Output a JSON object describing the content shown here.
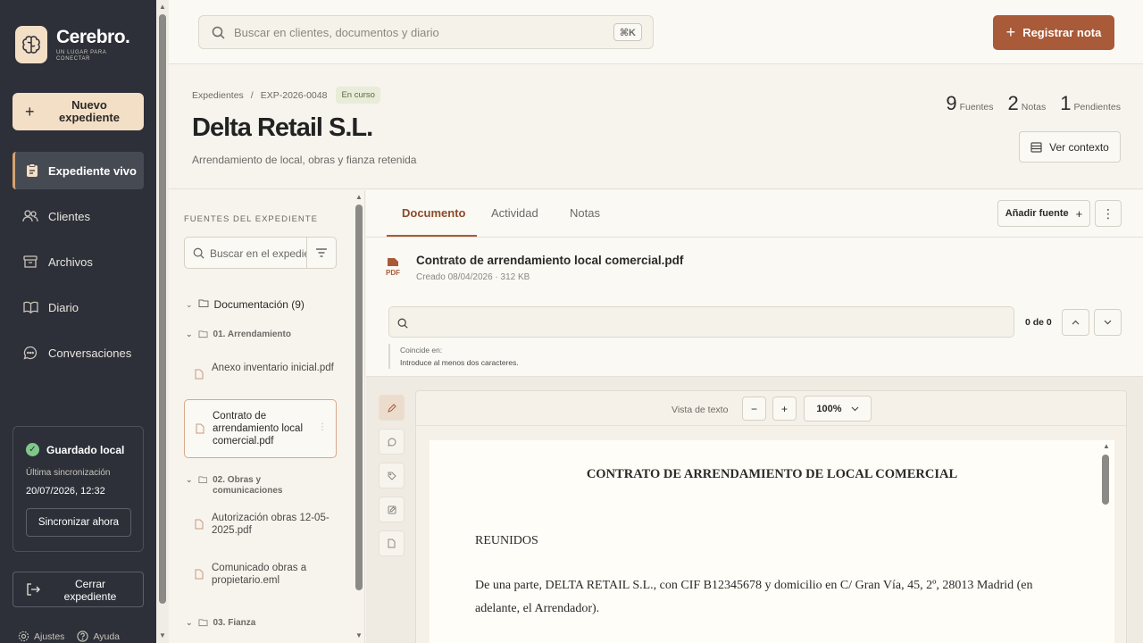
{
  "app": {
    "name": "Cerebro.",
    "tagline": "UN LUGAR PARA CONECTAR"
  },
  "sidebar": {
    "new_button": "Nuevo expediente",
    "items": [
      {
        "label": "Expediente vivo",
        "icon": "clipboard-icon",
        "active": true
      },
      {
        "label": "Clientes",
        "icon": "users-icon"
      },
      {
        "label": "Archivos",
        "icon": "archive-icon"
      },
      {
        "label": "Diario",
        "icon": "book-icon"
      },
      {
        "label": "Conversaciones",
        "icon": "chat-icon"
      }
    ],
    "sync": {
      "title": "Guardado local",
      "subtitle": "Última sincronización",
      "date": "20/07/2026, 12:32",
      "button": "Sincronizar ahora"
    },
    "close_button": "Cerrar expediente",
    "footer": {
      "settings": "Ajustes",
      "help": "Ayuda"
    }
  },
  "topbar": {
    "search_placeholder": "Buscar en clientes, documentos y diario",
    "shortcut": "⌘K",
    "register_button": "Registrar nota"
  },
  "header": {
    "breadcrumb": [
      "Expedientes",
      "EXP-2026-0048"
    ],
    "status": "En curso",
    "title": "Delta Retail S.L.",
    "subtitle": "Arrendamiento de local, obras y fianza retenida",
    "stats": [
      {
        "n": "9",
        "label": "Fuentes"
      },
      {
        "n": "2",
        "label": "Notas"
      },
      {
        "n": "1",
        "label": "Pendientes"
      }
    ],
    "context_button": "Ver contexto"
  },
  "sources": {
    "heading": "FUENTES DEL EXPEDIENTE",
    "search_placeholder": "Buscar en el expediente",
    "root": "Documentación (9)",
    "folders": [
      {
        "name": "01. Arrendamiento",
        "files": [
          "Anexo inventario inicial.pdf",
          "Contrato de arrendamiento local comercial.pdf"
        ]
      },
      {
        "name": "02. Obras y comunicaciones",
        "files": [
          "Autorización obras 12-05-2025.pdf",
          "Comunicado obras a propietario.eml"
        ]
      },
      {
        "name": "03. Fianza",
        "files": []
      }
    ]
  },
  "main": {
    "tabs": [
      "Documento",
      "Actividad",
      "Notas"
    ],
    "add_source": "Añadir fuente",
    "doc": {
      "type": "PDF",
      "name": "Contrato de arrendamiento local comercial.pdf",
      "meta": "Creado 08/04/2026 · 312 KB"
    },
    "find": {
      "count": "0 de 0",
      "hint_label": "Coincide en:",
      "hint_text": "Introduce al menos dos caracteres."
    },
    "viewer": {
      "mode_label": "Vista de texto",
      "zoom_out": "−",
      "zoom_in": "+",
      "zoom": "100%",
      "heading": "CONTRATO DE ARRENDAMIENTO DE LOCAL COMERCIAL",
      "section": "REUNIDOS",
      "paragraph": "De una parte, DELTA RETAIL S.L., con CIF B12345678 y domicilio en C/ Gran Vía, 45, 2º, 28013 Madrid (en adelante, el Arrendador)."
    }
  },
  "colors": {
    "accent": "#a95a38",
    "sidebar_bg": "#2d3038",
    "peach": "#f3dfc6",
    "status_green": "#7fc88a"
  }
}
